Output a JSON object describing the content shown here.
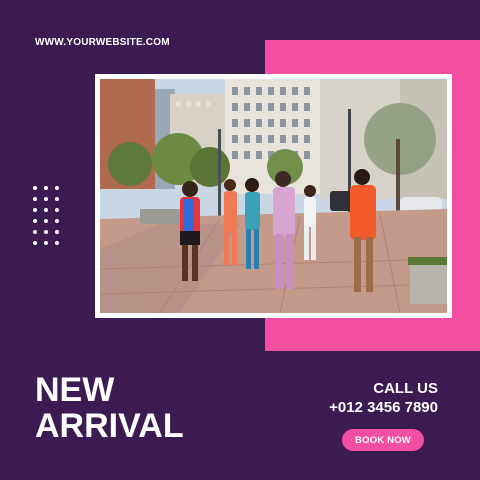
{
  "website": "WWW.YOURWEBSITE.COM",
  "headline": {
    "line1": "NEW",
    "line2": "ARRIVAL"
  },
  "contact": {
    "title": "CALL US",
    "phone": "+012 3456 7890"
  },
  "cta": {
    "label": "BOOK NOW"
  },
  "colors": {
    "background": "#3b1b52",
    "accent": "#f24fa3",
    "text": "#ffffff"
  },
  "photo": {
    "icon": "street-fashion-group-photo"
  }
}
